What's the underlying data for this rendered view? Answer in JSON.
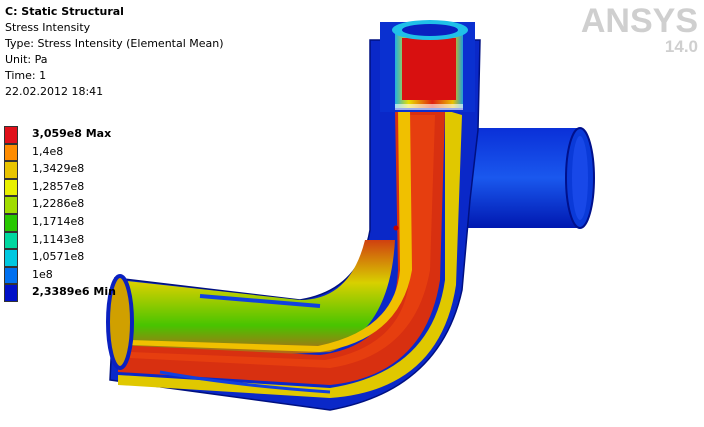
{
  "header": {
    "title": "C: Static Structural",
    "result": "Stress Intensity",
    "type": "Type: Stress Intensity (Elemental Mean)",
    "unit": "Unit: Pa",
    "time": "Time: 1",
    "date": "22.02.2012 18:41"
  },
  "legend": {
    "items": [
      {
        "label": "3,059e8 Max",
        "color": "#e0101a",
        "bold": true
      },
      {
        "label": "1,4e8",
        "color": "#ff8c00",
        "bold": false
      },
      {
        "label": "1,3429e8",
        "color": "#e8c400",
        "bold": false
      },
      {
        "label": "1,2857e8",
        "color": "#e8f000",
        "bold": false
      },
      {
        "label": "1,2286e8",
        "color": "#a0dc00",
        "bold": false
      },
      {
        "label": "1,1714e8",
        "color": "#28c800",
        "bold": false
      },
      {
        "label": "1,1143e8",
        "color": "#00d8a0",
        "bold": false
      },
      {
        "label": "1,0571e8",
        "color": "#00c8e0",
        "bold": false
      },
      {
        "label": "1e8",
        "color": "#0070f0",
        "bold": false
      },
      {
        "label": "2,3389e6 Min",
        "color": "#0010c8",
        "bold": true
      }
    ]
  },
  "brand": {
    "logo": "ANSYS",
    "version": "14.0"
  }
}
